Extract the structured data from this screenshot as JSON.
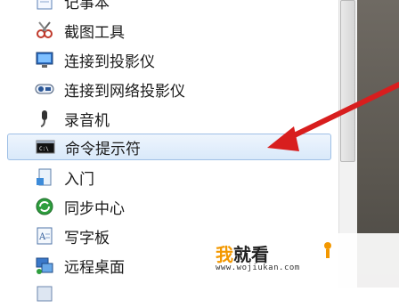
{
  "menu": {
    "items": [
      {
        "label": "记事本",
        "icon": "notepad-icon"
      },
      {
        "label": "截图工具",
        "icon": "snipping-tool-icon"
      },
      {
        "label": "连接到投影仪",
        "icon": "projector-icon"
      },
      {
        "label": "连接到网络投影仪",
        "icon": "network-projector-icon"
      },
      {
        "label": "录音机",
        "icon": "microphone-icon"
      },
      {
        "label": "命令提示符",
        "icon": "command-prompt-icon",
        "selected": true
      },
      {
        "label": "入门",
        "icon": "getting-started-icon"
      },
      {
        "label": "同步中心",
        "icon": "sync-center-icon"
      },
      {
        "label": "写字板",
        "icon": "wordpad-icon"
      },
      {
        "label": "远程桌面",
        "icon": "remote-desktop-icon"
      }
    ]
  },
  "watermark": {
    "title_wo": "我",
    "title_rest": "就看",
    "url": "www.wojiukan.com"
  },
  "colors": {
    "arrow": "#d81e1e",
    "selection": "#d9e9fa",
    "watermark_accent": "#f39800"
  }
}
